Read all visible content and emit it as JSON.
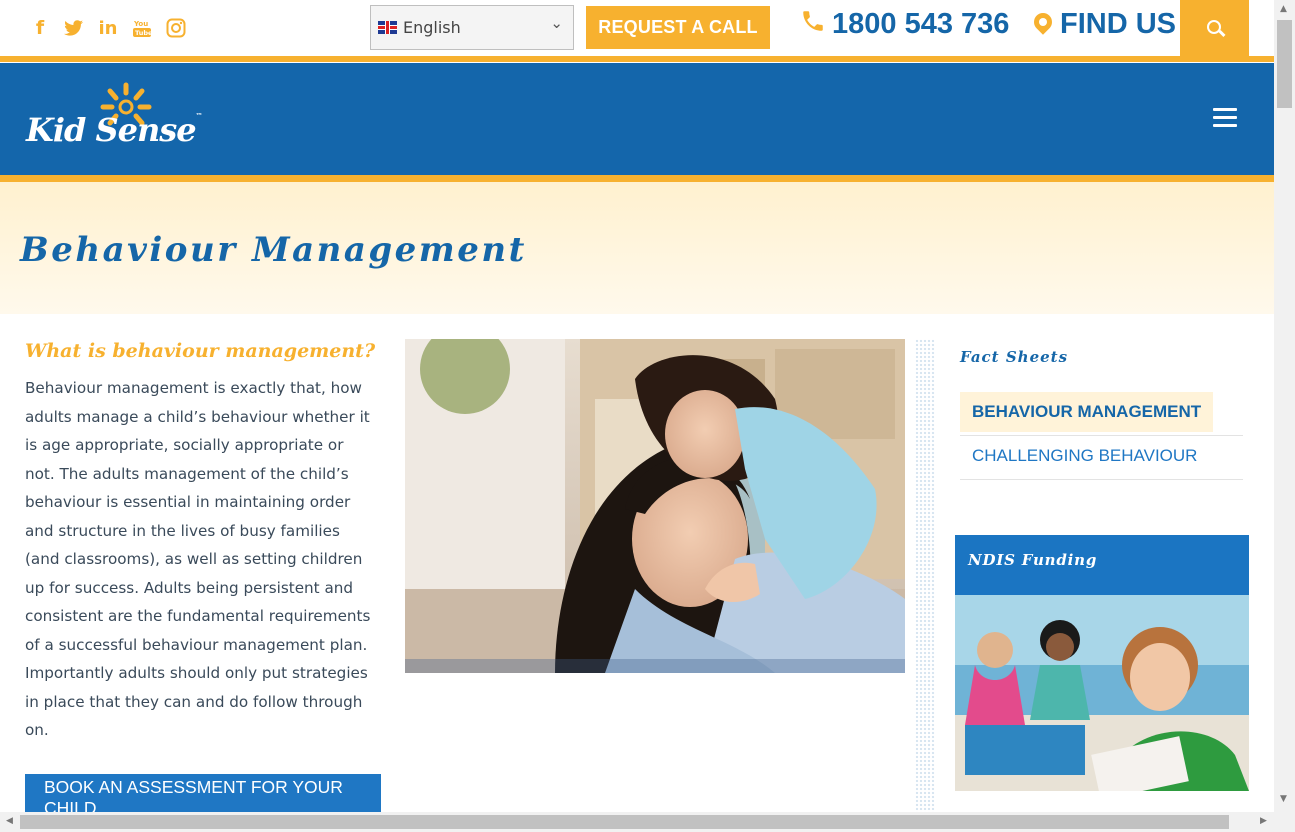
{
  "topbar": {
    "social": [
      {
        "name": "facebook-icon",
        "glyph": "f"
      },
      {
        "name": "twitter-icon",
        "glyph": "🐦"
      },
      {
        "name": "linkedin-icon",
        "glyph": "in"
      },
      {
        "name": "youtube-icon",
        "glyph": "▶"
      },
      {
        "name": "instagram-icon",
        "glyph": "◎"
      }
    ],
    "language": "English",
    "request_call": "REQUEST A CALL",
    "phone": "1800 543 736",
    "find_us": "FIND US"
  },
  "brand": {
    "logo_text": "Kid Sense",
    "trademark": "™"
  },
  "hero": {
    "title": "Behaviour Management"
  },
  "article": {
    "heading": "What is behaviour management?",
    "body": "Behaviour management is exactly that, how adults manage a child’s behaviour whether it is age appropriate, socially appropriate or not. The adults management of the child’s behaviour is essential in maintaining order and structure in the lives of busy families (and classrooms), as well as setting children up for success. Adults being persistent and consistent are the fundamental requirements of a successful behaviour management plan. Importantly adults should only put strategies in place that they can and do follow through on.",
    "cta": "BOOK AN ASSESSMENT FOR YOUR CHILD"
  },
  "sidebar": {
    "fact_title": "Fact Sheets",
    "items": [
      {
        "label": "BEHAVIOUR MANAGEMENT",
        "active": true
      },
      {
        "label": "CHALLENGING BEHAVIOUR",
        "active": false
      }
    ],
    "ndis_title": "NDIS Funding"
  },
  "colors": {
    "brand_blue": "#1466ab",
    "accent_yellow": "#f7b12f",
    "link_blue": "#1f77c4"
  }
}
